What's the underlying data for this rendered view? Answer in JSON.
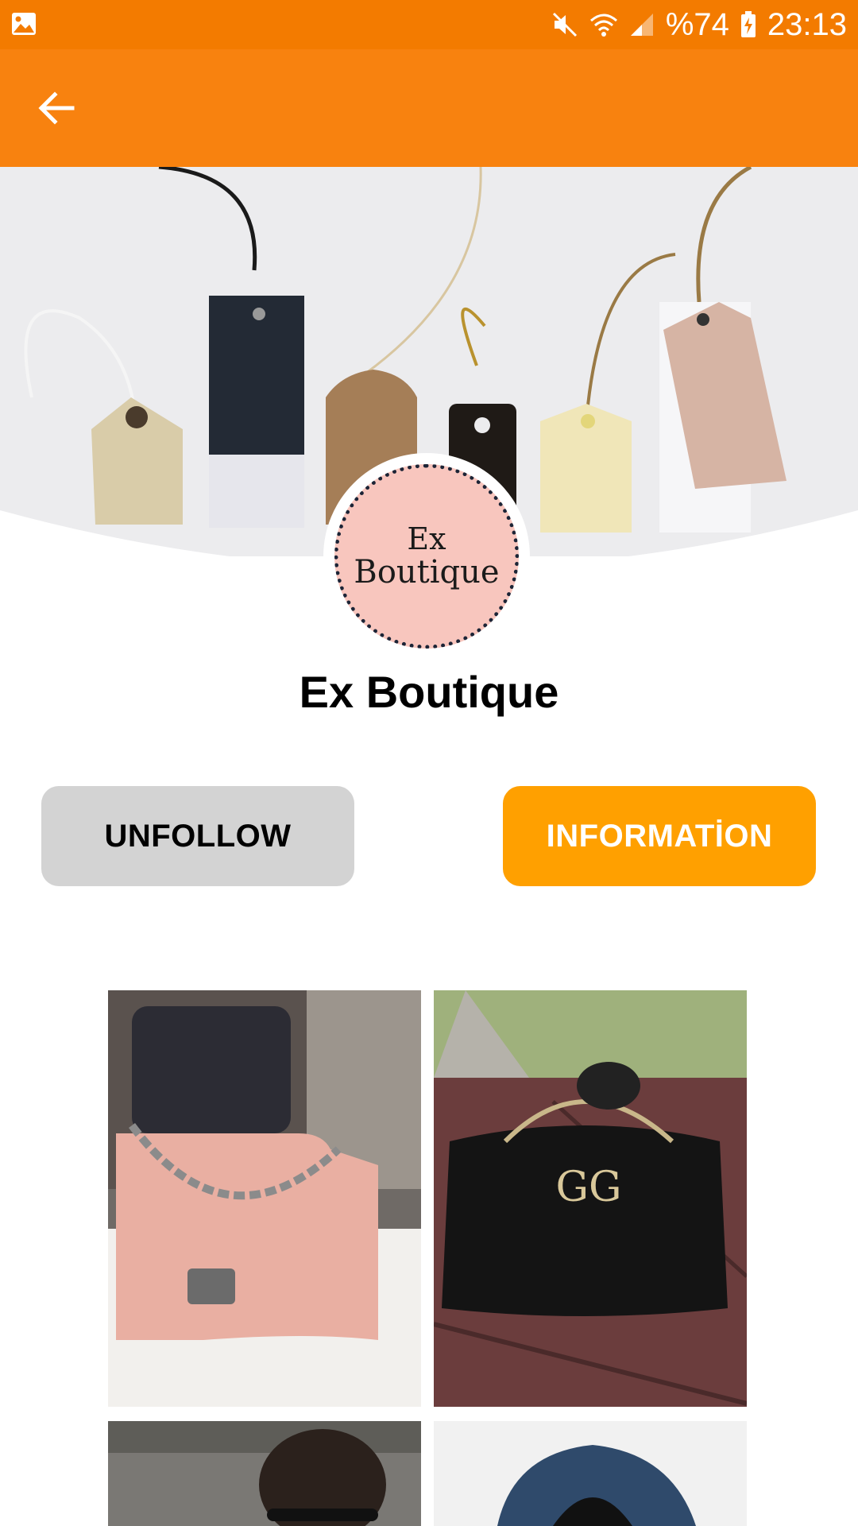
{
  "status_bar": {
    "battery": "%74",
    "time": "23:13",
    "icons": [
      "gallery-icon",
      "mute-icon",
      "wifi-icon",
      "signal-icon",
      "battery-charging-icon"
    ]
  },
  "app_bar": {
    "back_icon": "arrow-left-icon"
  },
  "store": {
    "logo_line1": "Ex",
    "logo_line2": "Boutique",
    "name": "Ex Boutique"
  },
  "actions": {
    "unfollow": "UNFOLLOW",
    "information": "INFORMATİON"
  },
  "colors": {
    "status_bar": "#F37B00",
    "app_bar": "#F8820F",
    "primary_button": "#FFA000",
    "secondary_button": "#D3D3D3",
    "logo_bg": "#F8C6BE"
  },
  "products": [
    {
      "image": "pink quilted handbag"
    },
    {
      "image": "black GG handbag"
    },
    {
      "image": "man with sunglasses"
    },
    {
      "image": "woman in denim jacket"
    }
  ]
}
